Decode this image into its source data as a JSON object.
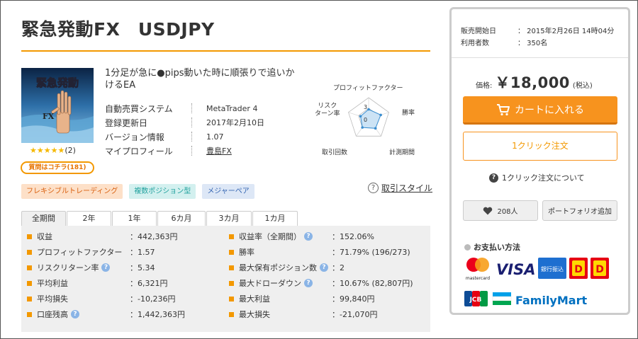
{
  "product": {
    "title": "緊急発動FX　USDJPY",
    "thumb_text": "緊急発動",
    "thumb_fx": "FX",
    "rating_stars": "★★★★★",
    "rating_count": "(2)",
    "question_button": "質問はコチラ(181)",
    "description": "1分足が急に●pips動いた時に順張りで追いかけるEA",
    "info": [
      {
        "key": "自動売買システム",
        "value": "MetaTrader 4",
        "link": false
      },
      {
        "key": "登録更新日",
        "value": "2017年2月10日",
        "link": false
      },
      {
        "key": "バージョン情報",
        "value": "1.07",
        "link": false
      },
      {
        "key": "マイプロフィール",
        "value": "豊島FX",
        "link": true
      }
    ]
  },
  "radar": {
    "labels": {
      "top": "プロフィットファクター",
      "right": "勝率",
      "bottom_right": "計測期間",
      "bottom_left": "取引回数",
      "left": "リスク\nターン率"
    },
    "left_line1": "リスク",
    "left_line2": "ターン率",
    "ticks": [
      "3",
      "0"
    ],
    "levels": [
      0.45,
      0.6,
      0.55,
      0.5,
      0.4
    ],
    "colors": {
      "fill": "#cce3f5",
      "stroke": "#3b8ed0"
    }
  },
  "tags": [
    "フレキシブルトレーディング",
    "複数ポジション型",
    "メジャーペア"
  ],
  "trade_style": {
    "icon": "question-icon",
    "glyph": "?",
    "label": "取引スタイル"
  },
  "tabs": [
    "全期間",
    "2年",
    "1年",
    "6カ月",
    "3カ月",
    "1カ月"
  ],
  "stats": [
    {
      "l1": "収益",
      "h1": false,
      "v1": "：442,363円",
      "l2": "収益率（全期間）",
      "h2": true,
      "v2": "：152.06%"
    },
    {
      "l1": "プロフィットファクター",
      "h1": false,
      "v1": "：1.57",
      "l2": "勝率",
      "h2": false,
      "v2": "：71.79% (196/273)"
    },
    {
      "l1": "リスクリターン率",
      "h1": true,
      "v1": "：5.34",
      "l2": "最大保有ポジション数",
      "h2": true,
      "v2": "：2"
    },
    {
      "l1": "平均利益",
      "h1": false,
      "v1": "：6,321円",
      "l2": "最大ドローダウン",
      "h2": true,
      "v2": "：10.67% (82,807円)"
    },
    {
      "l1": "平均損失",
      "h1": false,
      "v1": "：-10,236円",
      "l2": "最大利益",
      "h2": false,
      "v2": "：99,840円"
    },
    {
      "l1": "口座残高",
      "h1": true,
      "v1": "：1,442,363円",
      "l2": "最大損失",
      "h2": false,
      "v2": "：-21,070円"
    }
  ],
  "sidebar": {
    "meta": [
      {
        "key": "販売開始日",
        "value": "：  2015年2月26日 14時04分"
      },
      {
        "key": "利用者数",
        "value": "：  350名"
      }
    ],
    "price_label": "価格:",
    "price_value": "￥18,000",
    "price_tax": "(税込)",
    "cart_button": "カートに入れる",
    "one_click_button": "1クリック注文",
    "about_one_click": "1クリック注文について",
    "favorite_count": "208人",
    "portfolio_button": "ポートフォリオ追加",
    "payment_title": "お支払い方法",
    "payment": {
      "mastercard": "mastercard",
      "visa": "VISA",
      "bank": "銀行振込",
      "jcb": "JCB",
      "familymart": "FamilyMart"
    }
  },
  "colors": {
    "accent": "#f39800",
    "cart": "#f7931e"
  }
}
